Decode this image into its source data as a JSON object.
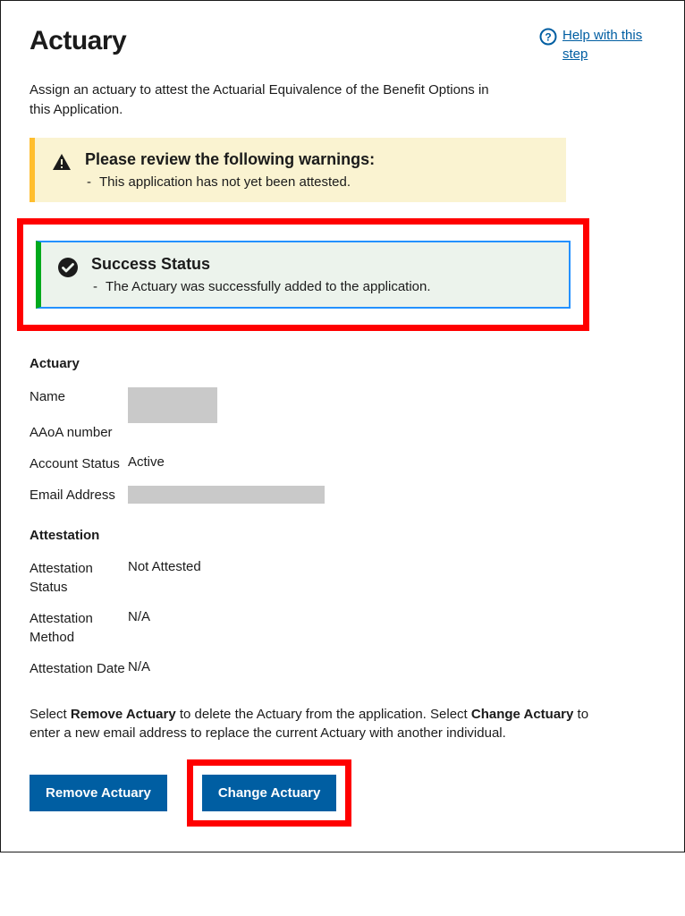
{
  "header": {
    "title": "Actuary",
    "help_link": "Help with this step"
  },
  "intro": "Assign an actuary to attest the Actuarial Equivalence of the Benefit Options in this Application.",
  "warning": {
    "heading": "Please review the following warnings:",
    "items": [
      "This application has not yet been attested."
    ]
  },
  "success": {
    "heading": "Success Status",
    "items": [
      "The Actuary was successfully added to the application."
    ]
  },
  "actuary_section": {
    "heading": "Actuary",
    "rows": {
      "name_label": "Name",
      "aaoa_label": "AAoA number",
      "account_status_label": "Account Status",
      "account_status_value": "Active",
      "email_label": "Email Address"
    }
  },
  "attestation_section": {
    "heading": "Attestation",
    "rows": {
      "status_label": "Attestation Status",
      "status_value": "Not Attested",
      "method_label": "Attestation Method",
      "method_value": "N/A",
      "date_label": "Attestation Date",
      "date_value": "N/A"
    }
  },
  "button_help": {
    "part1": "Select ",
    "bold1": "Remove Actuary",
    "part2": " to delete the Actuary from the application. Select ",
    "bold2": "Change Actuary",
    "part3": " to enter a new email address to replace the current Actuary with another individual."
  },
  "buttons": {
    "remove": "Remove Actuary",
    "change": "Change Actuary"
  }
}
